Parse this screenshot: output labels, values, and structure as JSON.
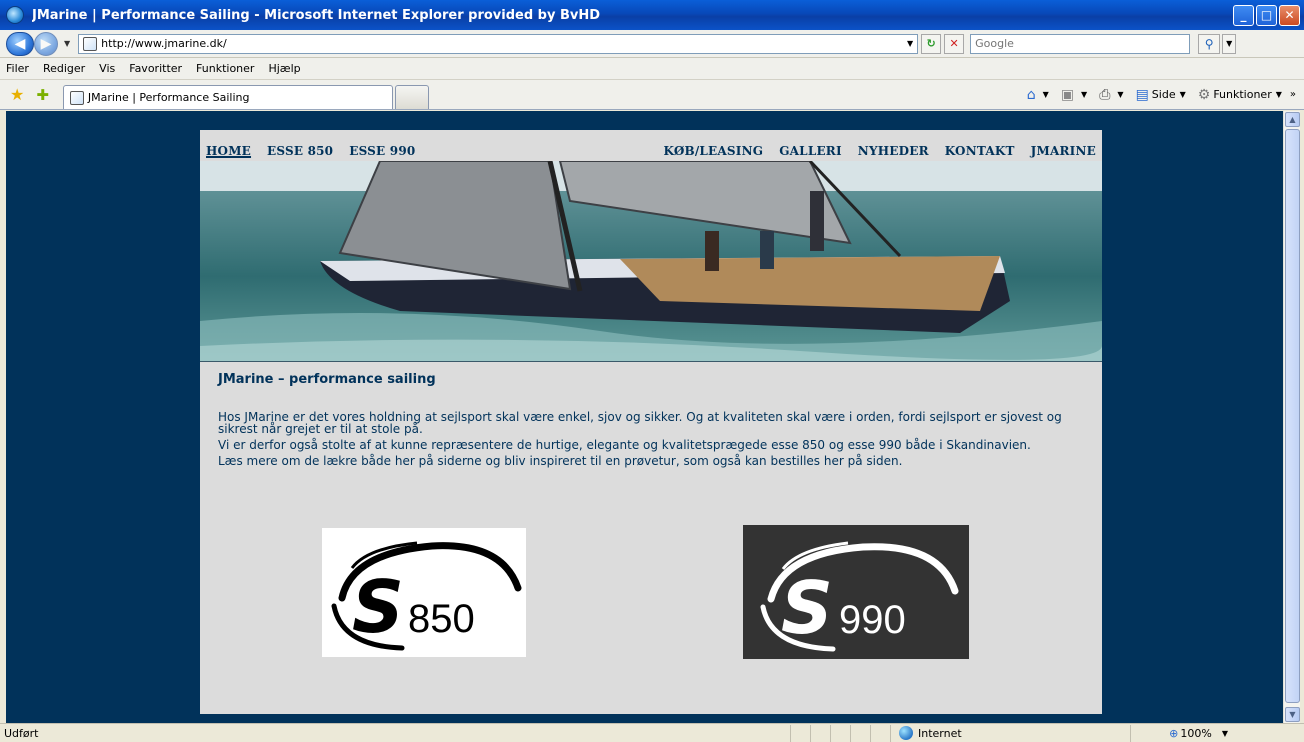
{
  "window": {
    "title": "JMarine | Performance Sailing - Microsoft Internet Explorer provided by BvHD",
    "min": "_",
    "max": "□",
    "close": "✕"
  },
  "address": {
    "url": "http://www.jmarine.dk/",
    "search_placeholder": "Google"
  },
  "menu": [
    "Filer",
    "Rediger",
    "Vis",
    "Favoritter",
    "Funktioner",
    "Hjælp"
  ],
  "tabbar": {
    "active_tab": "JMarine | Performance Sailing",
    "tools": {
      "page": "Side",
      "tools": "Funktioner"
    }
  },
  "site": {
    "nav_left": [
      "HOME",
      "ESSE 850",
      "ESSE 990"
    ],
    "nav_right": [
      "KØB/LEASING",
      "GALLERI",
      "NYHEDER",
      "KONTAKT",
      "JMARINE"
    ],
    "heading": "JMarine – performance sailing",
    "paragraphs": [
      "Hos JMarine er det vores holdning at sejlsport skal være enkel, sjov og sikker. Og at kvaliteten skal være i orden, fordi sejlsport er sjovest og sikrest når grejet er til at stole på.",
      "Vi er derfor også stolte af at kunne repræsentere de hurtige, elegante og kvalitetsprægede esse 850 og esse 990 både i Skandinavien.",
      "Læs mere om de lækre både her på siderne og bliv inspireret til en prøvetur, som også kan bestilles her på siden."
    ],
    "logo850_text": "850",
    "logo990_text": "990",
    "logo_letter": "S"
  },
  "status": {
    "text": "Udført",
    "zone": "Internet",
    "zoom": "100%"
  },
  "colors": {
    "page_bg": "#01325a",
    "content_bg": "#dcdcdc",
    "text": "#01325a"
  }
}
